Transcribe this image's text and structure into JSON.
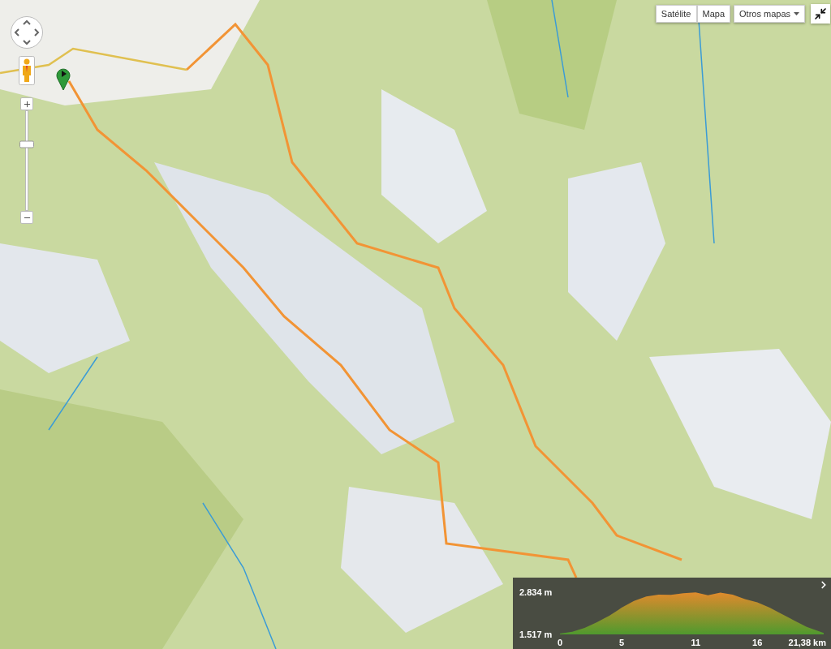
{
  "map_type_buttons": [
    {
      "label": "Satélite",
      "selected": false
    },
    {
      "label": "Mapa",
      "selected": false
    }
  ],
  "other_maps": {
    "label": "Otros mapas"
  },
  "zoom": {
    "level": 0.66
  },
  "elevation_profile": {
    "chart_data": {
      "type": "area",
      "x": [
        0,
        1,
        2,
        3,
        4,
        5,
        6,
        7,
        8,
        9,
        10,
        11,
        12,
        13,
        14,
        15,
        16,
        17,
        18,
        19,
        20,
        21.38
      ],
      "series": [
        {
          "color": "#e08a2c",
          "values": [
            1.54,
            1.6,
            1.72,
            1.9,
            2.1,
            2.35,
            2.56,
            2.7,
            2.76,
            2.75,
            2.8,
            2.83,
            2.74,
            2.82,
            2.76,
            2.62,
            2.52,
            2.35,
            2.15,
            1.95,
            1.75,
            1.56
          ]
        }
      ],
      "xlim": [
        0,
        21.38
      ],
      "ylim": [
        1.517,
        2.834
      ],
      "xticks": [
        0,
        5,
        11,
        16,
        {
          "value": 21.38,
          "label": "21,38 km"
        }
      ],
      "yticks": [
        {
          "value": 1.517,
          "label": "1.517 m"
        },
        {
          "value": 2.834,
          "label": "2.834 m"
        }
      ]
    }
  }
}
